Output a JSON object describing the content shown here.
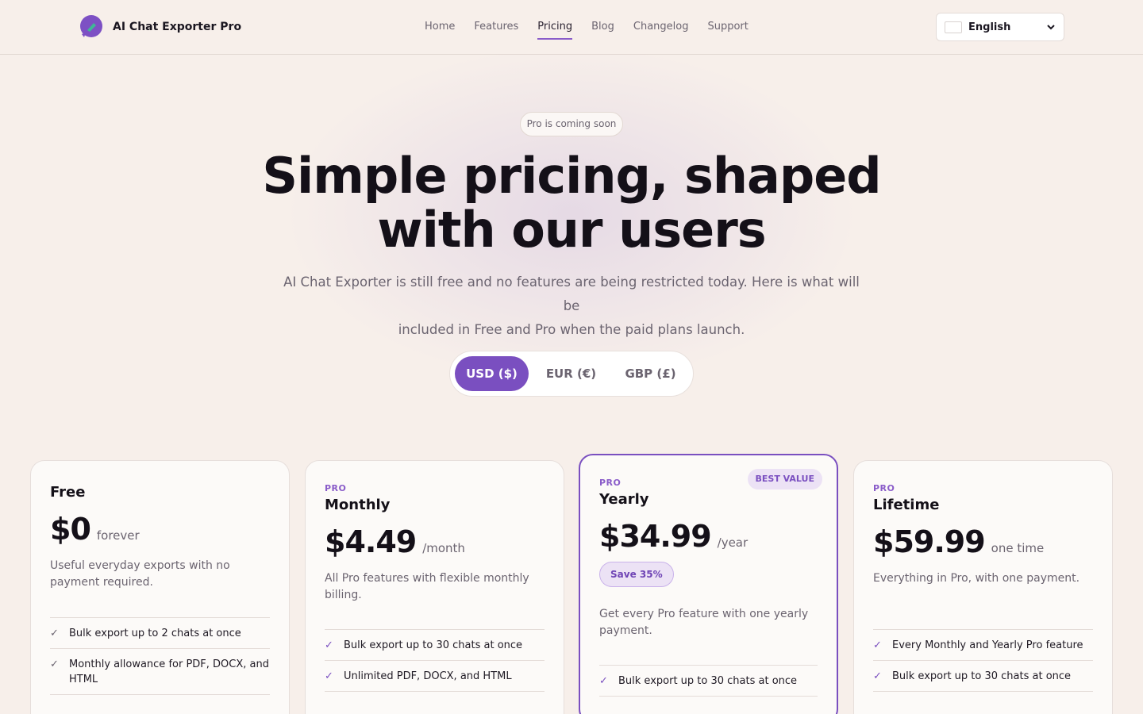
{
  "header": {
    "brand": "AI Chat Exporter Pro",
    "nav": [
      {
        "label": "Home"
      },
      {
        "label": "Features"
      },
      {
        "label": "Pricing",
        "active": true
      },
      {
        "label": "Blog"
      },
      {
        "label": "Changelog"
      },
      {
        "label": "Support"
      }
    ],
    "language": "English"
  },
  "hero": {
    "badge": "Pro is coming soon",
    "title_line1": "Simple pricing, shaped",
    "title_line2": "with our users",
    "subtitle_line1": "AI Chat Exporter is still free and no features are being restricted today. Here is what will be",
    "subtitle_line2": "included in Free and Pro when the paid plans launch."
  },
  "currency": {
    "options": [
      "USD ($)",
      "EUR (€)",
      "GBP (£)"
    ],
    "selected": "USD ($)"
  },
  "plans": [
    {
      "tier": "",
      "name": "Free",
      "price": "$0",
      "period": "forever",
      "desc": "Useful everyday exports with no payment required.",
      "features": [
        "Bulk export up to 2 chats at once",
        "Monthly allowance for PDF, DOCX, and HTML"
      ]
    },
    {
      "tier": "PRO",
      "name": "Monthly",
      "price": "$4.49",
      "period": "/month",
      "desc": "All Pro features with flexible monthly billing.",
      "features": [
        "Bulk export up to 30 chats at once",
        "Unlimited PDF, DOCX, and HTML"
      ]
    },
    {
      "tier": "PRO",
      "name": "Yearly",
      "price": "$34.99",
      "period": "/year",
      "badge": "BEST VALUE",
      "save": "Save 35%",
      "desc": "Get every Pro feature with one yearly payment.",
      "features": [
        "Bulk export up to 30 chats at once"
      ]
    },
    {
      "tier": "PRO",
      "name": "Lifetime",
      "price": "$59.99",
      "period": "one time",
      "desc": "Everything in Pro, with one payment.",
      "features": [
        "Every Monthly and Yearly Pro feature",
        "Bulk export up to 30 chats at once"
      ]
    }
  ],
  "colors": {
    "accent": "#7a4fc0",
    "background": "#f7efea",
    "card": "#fcfaf8"
  }
}
